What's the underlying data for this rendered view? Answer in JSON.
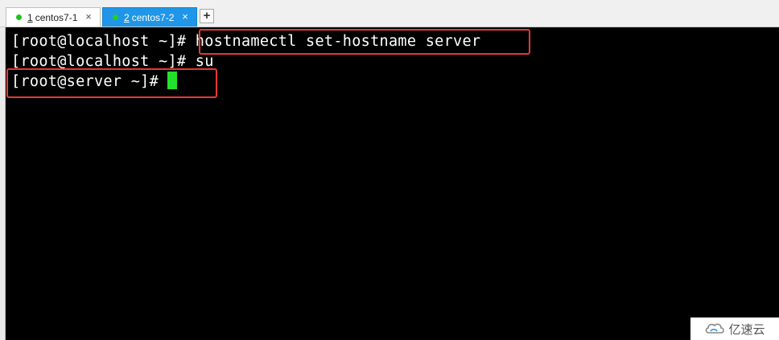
{
  "tabs": [
    {
      "number": "1",
      "label": "centos7-1",
      "dot_color": "#1fc21f",
      "active": false
    },
    {
      "number": "2",
      "label": "centos7-2",
      "dot_color": "#1fd01f",
      "active": true
    }
  ],
  "tab_add_label": "+",
  "tab_close_label": "×",
  "terminal": {
    "lines": [
      {
        "prompt": "[root@localhost ~]#",
        "command": " hostnamectl set-hostname server"
      },
      {
        "prompt": "[root@localhost ~]#",
        "command": " su"
      },
      {
        "prompt": "[root@server ~]#",
        "command": ""
      }
    ],
    "cursor_color": "#25e02a",
    "highlight_color": "#e53935"
  },
  "watermark": {
    "text": "亿速云",
    "icon": "cloud-logo-icon"
  }
}
